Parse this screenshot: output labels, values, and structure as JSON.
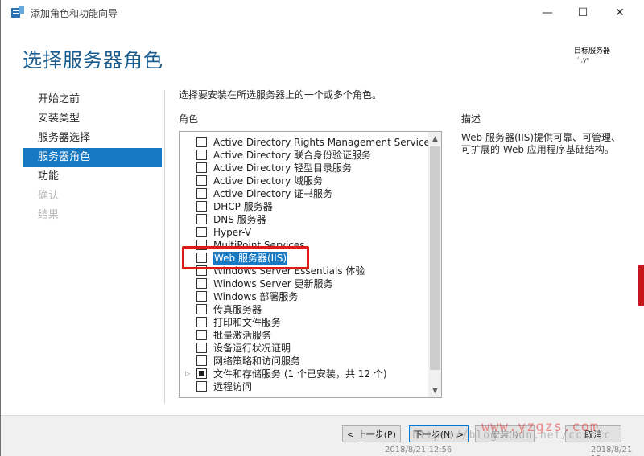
{
  "window": {
    "title": "添加角色和功能向导",
    "icon": "server-manager-icon",
    "controls": {
      "minimize": "—",
      "maximize": "☐",
      "close": "✕"
    }
  },
  "header": {
    "title": "选择服务器角色",
    "target_label": "目标服务器",
    "target_value": "ˈ     ˌyⁿ"
  },
  "nav": {
    "items": [
      {
        "label": "开始之前",
        "state": "normal"
      },
      {
        "label": "安装类型",
        "state": "normal"
      },
      {
        "label": "服务器选择",
        "state": "normal"
      },
      {
        "label": "服务器角色",
        "state": "active"
      },
      {
        "label": "功能",
        "state": "normal"
      },
      {
        "label": "确认",
        "state": "disabled"
      },
      {
        "label": "结果",
        "state": "disabled"
      }
    ]
  },
  "main": {
    "instruction": "选择要安装在所选服务器上的一个或多个角色。",
    "roles_heading": "角色",
    "description_heading": "描述",
    "description_text": "Web 服务器(IIS)提供可靠、可管理、可扩展的 Web 应用程序基础结构。",
    "roles": [
      {
        "label": "Active Directory Rights Management Services",
        "checked": "none",
        "expandable": false,
        "selected": false
      },
      {
        "label": "Active Directory 联合身份验证服务",
        "checked": "none",
        "expandable": false,
        "selected": false
      },
      {
        "label": "Active Directory 轻型目录服务",
        "checked": "none",
        "expandable": false,
        "selected": false
      },
      {
        "label": "Active Directory 域服务",
        "checked": "none",
        "expandable": false,
        "selected": false
      },
      {
        "label": "Active Directory 证书服务",
        "checked": "none",
        "expandable": false,
        "selected": false
      },
      {
        "label": "DHCP 服务器",
        "checked": "none",
        "expandable": false,
        "selected": false
      },
      {
        "label": "DNS 服务器",
        "checked": "none",
        "expandable": false,
        "selected": false
      },
      {
        "label": "Hyper-V",
        "checked": "none",
        "expandable": false,
        "selected": false
      },
      {
        "label": "MultiPoint Services",
        "checked": "none",
        "expandable": false,
        "selected": false
      },
      {
        "label": "Web 服务器(IIS)",
        "checked": "none",
        "expandable": false,
        "selected": true
      },
      {
        "label": "Windows Server Essentials 体验",
        "checked": "none",
        "expandable": false,
        "selected": false
      },
      {
        "label": "Windows Server 更新服务",
        "checked": "none",
        "expandable": false,
        "selected": false
      },
      {
        "label": "Windows 部署服务",
        "checked": "none",
        "expandable": false,
        "selected": false
      },
      {
        "label": "传真服务器",
        "checked": "none",
        "expandable": false,
        "selected": false
      },
      {
        "label": "打印和文件服务",
        "checked": "none",
        "expandable": false,
        "selected": false
      },
      {
        "label": "批量激活服务",
        "checked": "none",
        "expandable": false,
        "selected": false
      },
      {
        "label": "设备运行状况证明",
        "checked": "none",
        "expandable": false,
        "selected": false
      },
      {
        "label": "网络策略和访问服务",
        "checked": "none",
        "expandable": false,
        "selected": false
      },
      {
        "label": "文件和存储服务 (1 个已安装，共 12 个)",
        "checked": "partial",
        "expandable": true,
        "selected": false
      },
      {
        "label": "远程访问",
        "checked": "none",
        "expandable": false,
        "selected": false
      }
    ]
  },
  "footer": {
    "prev": "< 上一步(P)",
    "next": "下一步(N) >",
    "install": "安装(I)",
    "cancel": "取消"
  },
  "watermarks": {
    "site": "www.yzgzs.com",
    "blog": "https://blog.csdn.net/cccccc",
    "background_left": "2018/8/21 12:56",
    "background_right": "2018/8/21 12"
  },
  "colors": {
    "accent": "#1679c4",
    "title": "#1a5c8e",
    "highlight_box": "#e01919"
  }
}
